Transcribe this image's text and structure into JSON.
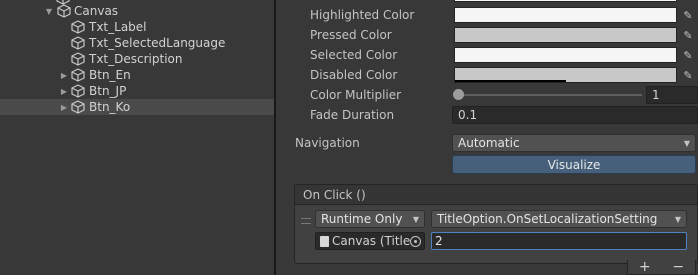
{
  "hierarchy": {
    "items": [
      {
        "label": "Canvas",
        "expanded": true
      },
      {
        "label": "Txt_Label"
      },
      {
        "label": "Txt_SelectedLanguage"
      },
      {
        "label": "Txt_Description"
      },
      {
        "label": "Btn_En",
        "expanded": false
      },
      {
        "label": "Btn_JP",
        "expanded": false
      },
      {
        "label": "Btn_Ko",
        "expanded": false,
        "selected": true
      }
    ]
  },
  "inspector": {
    "colors": [
      {
        "label": "Highlighted Color",
        "value": "#f5f5f5",
        "alpha_fraction": 0
      },
      {
        "label": "Pressed Color",
        "value": "#c8c8c8",
        "alpha_fraction": 0
      },
      {
        "label": "Selected Color",
        "value": "#f5f5f5",
        "alpha_fraction": 0
      },
      {
        "label": "Disabled Color",
        "value": "#c8c8c8",
        "alpha_fraction": 0.5
      }
    ],
    "color_multiplier": {
      "label": "Color Multiplier",
      "value": "1",
      "fraction": 0
    },
    "fade_duration": {
      "label": "Fade Duration",
      "value": "0.1"
    },
    "navigation": {
      "label": "Navigation",
      "value": "Automatic"
    },
    "visualize_label": "Visualize",
    "on_click": {
      "title": "On Click ()",
      "runtime_mode": "Runtime Only",
      "function": "TitleOption.OnSetLocalizationSetting",
      "object": "Canvas (Title",
      "argument": "2"
    },
    "add_label": "+",
    "remove_label": "−"
  },
  "icons": {
    "gameobject": "cube-icon",
    "picker": "eyedropper-icon",
    "target": "object-picker-icon"
  },
  "colors": {
    "panel_bg": "#383838",
    "selected_row": "#4a4a4a",
    "visualize_bg": "#46607c",
    "focus_border": "#4e82c2"
  }
}
